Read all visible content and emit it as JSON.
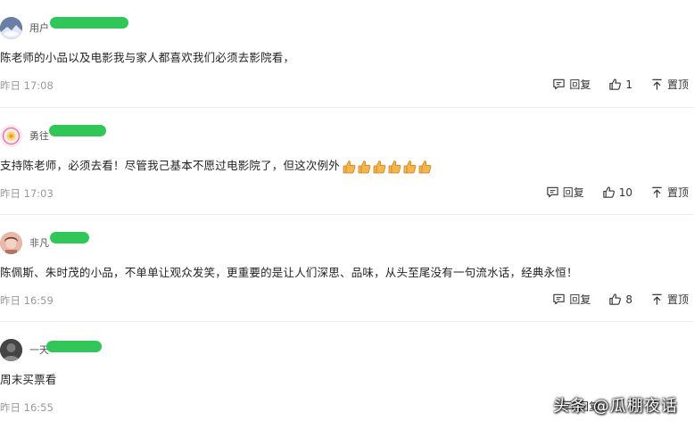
{
  "comments": [
    {
      "username": "用户",
      "text": "陈老师的小品以及电影我与家人都喜欢我们必须去影院看，",
      "time": "昨日 17:08",
      "reply_label": "回复",
      "like_count": "1",
      "pin_label": "置顶",
      "avatar_icon": "mountain-avatar"
    },
    {
      "username": "勇往",
      "text": "支持陈老师，必须去看！尽管我己基本不愿过电影院了，但这次例外",
      "emoji": "thumbs-up",
      "emoji_count": 6,
      "time": "昨日 17:03",
      "reply_label": "回复",
      "like_count": "10",
      "pin_label": "置顶",
      "avatar_icon": "flower-avatar"
    },
    {
      "username": "非凡",
      "text": "陈佩斯、朱时茂的小品，不单单让观众发笑，更重要的是让人们深思、品味，从头至尾没有一句流水话，经典永恒！",
      "time": "昨日 16:59",
      "reply_label": "回复",
      "like_count": "8",
      "pin_label": "置顶",
      "avatar_icon": "girl-avatar"
    },
    {
      "username": "一天",
      "text": "周末买票看",
      "time": "昨日 16:55",
      "reply_label": "回复",
      "avatar_icon": "dark-avatar"
    }
  ],
  "watermark": "头条 @瓜棚夜话",
  "colors": {
    "scribble": "#1fc24a",
    "time_text": "#999999",
    "divider": "#ececec"
  }
}
